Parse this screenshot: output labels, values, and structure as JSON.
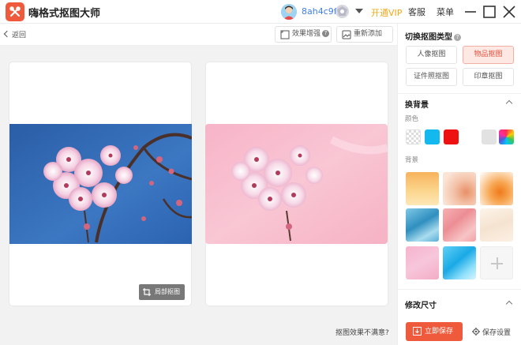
{
  "app": {
    "title": "嗨格式抠图大师"
  },
  "user": {
    "name": "8ah4c9f"
  },
  "titlebar": {
    "vip": "开通VIP",
    "service": "客服",
    "menu": "菜单"
  },
  "toolbar": {
    "back": "返回",
    "enhance": "效果增强",
    "readd": "重新添加"
  },
  "canvas": {
    "local_crop": "局部抠图",
    "not_satisfied": "抠图效果不满意?"
  },
  "right": {
    "cutout_type_title": "切换抠图类型",
    "types": [
      "人像抠图",
      "物品抠图",
      "证件照抠图",
      "印章抠图"
    ],
    "active_type": "物品抠图",
    "bg_title": "换背景",
    "color_label": "颜色",
    "bg_label": "背景",
    "colors": [
      "transparent",
      "#12b8ee",
      "#ee1111",
      "#ffffff",
      "#e2e2e2",
      "rainbow"
    ],
    "resize_title": "修改尺寸",
    "save_now": "立即保存",
    "save_settings": "保存设置"
  }
}
